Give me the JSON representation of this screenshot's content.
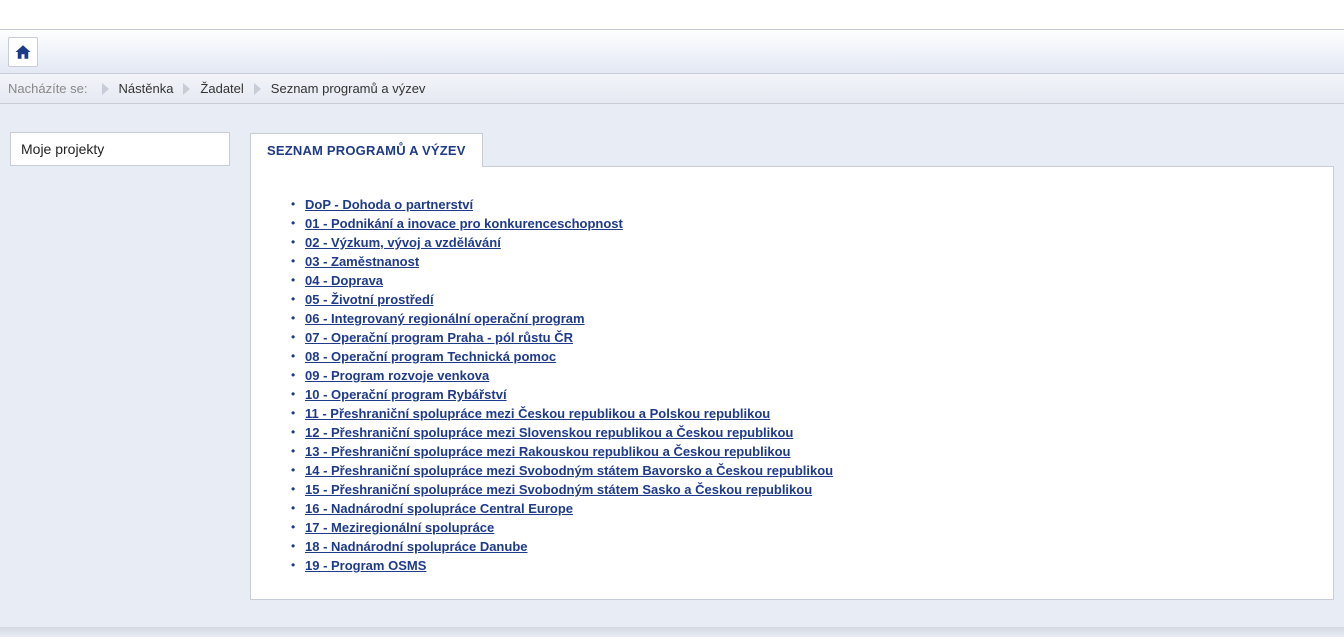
{
  "breadcrumb": {
    "label": "Nacházíte se:",
    "items": [
      "Nástěnka",
      "Žadatel"
    ],
    "current": "Seznam programů a výzev"
  },
  "sidebar": {
    "my_projects": "Moje projekty"
  },
  "main": {
    "tab_title": "SEZNAM PROGRAMŮ A VÝZEV",
    "programs": [
      "DoP - Dohoda o partnerství",
      "01 - Podnikání a inovace pro konkurenceschopnost",
      "02 - Výzkum, vývoj a vzdělávání",
      "03 - Zaměstnanost",
      "04 - Doprava",
      "05 - Životní prostředí",
      "06 - Integrovaný regionální operační program",
      "07 - Operační program Praha - pól růstu ČR",
      "08 - Operační program Technická pomoc",
      "09 - Program rozvoje venkova",
      "10 - Operační program Rybářství",
      "11 - Přeshraniční spolupráce mezi Českou republikou a Polskou republikou",
      "12 - Přeshraniční spolupráce mezi Slovenskou republikou a Českou republikou",
      "13 - Přeshraniční spolupráce mezi Rakouskou republikou a Českou republikou",
      "14 - Přeshraniční spolupráce mezi Svobodným státem Bavorsko a Českou republikou",
      "15 - Přeshraniční spolupráce mezi Svobodným státem Sasko a Českou republikou",
      "16 - Nadnárodní spolupráce Central Europe",
      "17 - Meziregionální spolupráce",
      "18 - Nadnárodní spolupráce Danube",
      "19 - Program OSMS"
    ]
  }
}
